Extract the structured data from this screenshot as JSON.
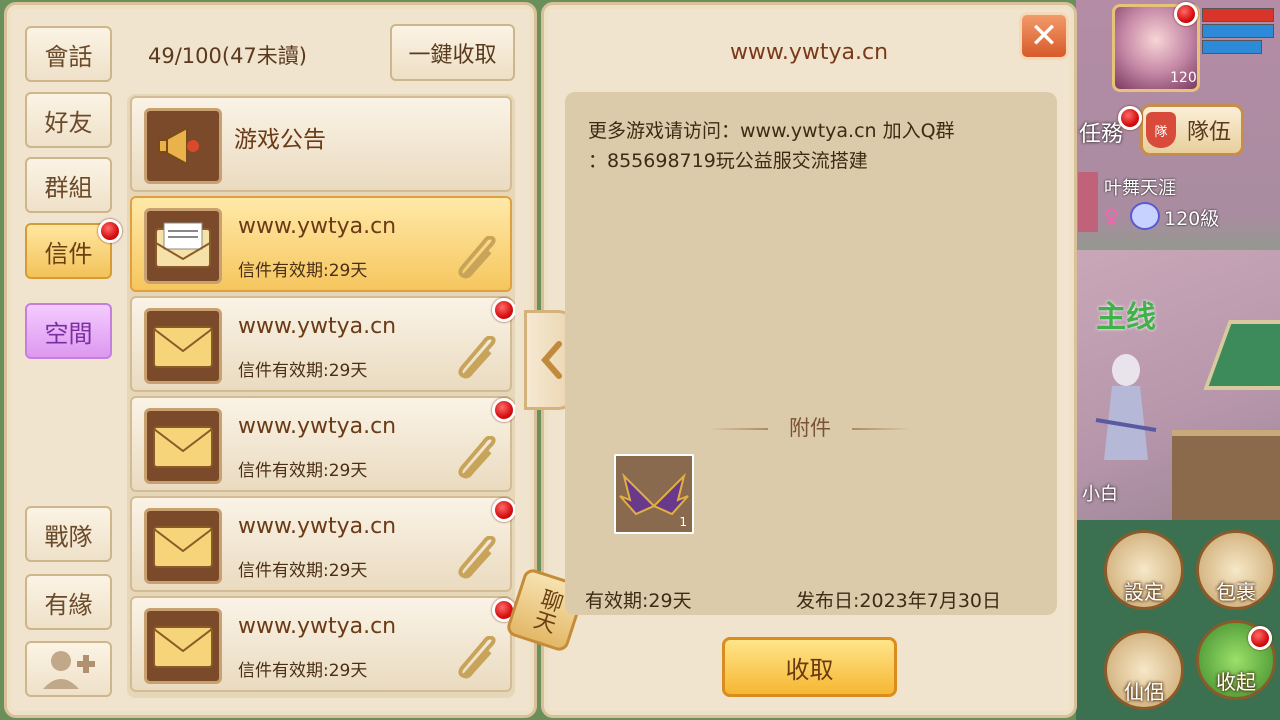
{
  "sidebar": {
    "tabs": [
      {
        "label": "會話"
      },
      {
        "label": "好友"
      },
      {
        "label": "群組"
      },
      {
        "label": "信件"
      },
      {
        "label": "空間"
      }
    ],
    "bottom_tabs": [
      {
        "label": "戰隊"
      },
      {
        "label": "有緣"
      }
    ]
  },
  "header": {
    "unread_count": "49/100(47未讀)",
    "collect_all_label": "一鍵收取"
  },
  "mail_list": {
    "notice": {
      "title": "游戏公告"
    },
    "items": [
      {
        "title": "www.ywtya.cn",
        "expiry": "信件有效期:29天",
        "selected": true,
        "unread": false
      },
      {
        "title": "www.ywtya.cn",
        "expiry": "信件有效期:29天",
        "selected": false,
        "unread": true
      },
      {
        "title": "www.ywtya.cn",
        "expiry": "信件有效期:29天",
        "selected": false,
        "unread": true
      },
      {
        "title": "www.ywtya.cn",
        "expiry": "信件有效期:29天",
        "selected": false,
        "unread": true
      },
      {
        "title": "www.ywtya.cn",
        "expiry": "信件有效期:29天",
        "selected": false,
        "unread": true
      }
    ]
  },
  "chat_tag": "聊天",
  "detail": {
    "title": "www.ywtya.cn",
    "body": "更多游戏请访问：www.ywtya.cn 加入Q群\n：855698719玩公益服交流搭建",
    "attachment_label": "附件",
    "attachment_qty": "1",
    "validity": "有效期:29天",
    "publish_date": "发布日:2023年7月30日",
    "receive_label": "收取",
    "close_icon": "close-icon"
  },
  "hud": {
    "level": "120",
    "team_label": "隊伍",
    "team_badge": "隊",
    "player_name": "叶舞天涯",
    "player_level": "120級",
    "quest_text": "主线",
    "npc_name": "小白",
    "partial_text": "任務",
    "settings_label": "設定",
    "bag_label": "包裹",
    "partner_label": "仙侶",
    "fold_label": "收起"
  },
  "colors": {
    "accent": "#f3c25a",
    "panel": "#f1e4cf",
    "unread_dot": "#d60f0f"
  }
}
